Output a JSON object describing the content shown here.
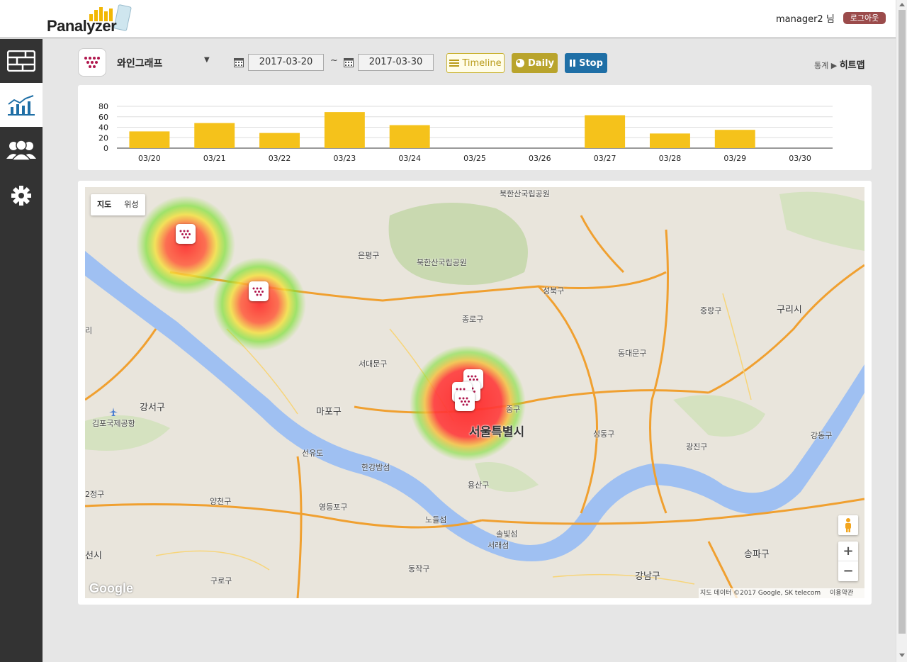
{
  "header": {
    "logo_text": "Panalyzer",
    "user": "manager2 님",
    "logout_label": "로그아웃"
  },
  "sidebar": {
    "items": [
      {
        "icon": "dashboard-icon"
      },
      {
        "icon": "chart-icon",
        "active": true
      },
      {
        "icon": "users-icon"
      },
      {
        "icon": "gear-icon"
      }
    ]
  },
  "toolbar": {
    "app_name": "와인그래프",
    "dropdown_symbol": "▼",
    "start_date": "2017-03-20",
    "tilde": "~",
    "end_date": "2017-03-30",
    "timeline_label": "Timeline",
    "daily_label": "Daily",
    "stop_label": "Stop"
  },
  "breadcrumb": {
    "parent": "통계",
    "arrow": "▶",
    "current": "히트맵"
  },
  "chart_data": {
    "type": "bar",
    "categories": [
      "03/20",
      "03/21",
      "03/22",
      "03/23",
      "03/24",
      "03/25",
      "03/26",
      "03/27",
      "03/28",
      "03/29",
      "03/30"
    ],
    "values": [
      32,
      48,
      29,
      69,
      44,
      0,
      0,
      63,
      28,
      35,
      0
    ],
    "yticks": [
      0,
      20,
      40,
      60,
      80
    ],
    "ylim": [
      0,
      80
    ],
    "color": "#f5c21b",
    "grid": true
  },
  "map": {
    "type_controls": {
      "map": "지도",
      "satellite": "위성"
    },
    "labels": [
      {
        "text": "북한산국립공원",
        "style": "sm"
      },
      {
        "text": "은평구",
        "style": "sm"
      },
      {
        "text": "북한산국립공원",
        "style": "sm"
      },
      {
        "text": "성북구",
        "style": "sm"
      },
      {
        "text": "종로구",
        "style": "sm"
      },
      {
        "text": "중랑구",
        "style": "sm"
      },
      {
        "text": "구리시",
        "style": "md"
      },
      {
        "text": "동대문구",
        "style": "sm"
      },
      {
        "text": "서대문구",
        "style": "sm"
      },
      {
        "text": "중구",
        "style": "sm"
      },
      {
        "text": "서울특별시",
        "style": "big"
      },
      {
        "text": "강서구",
        "style": "md"
      },
      {
        "text": "김포국제공항",
        "style": "sm"
      },
      {
        "text": "마포구",
        "style": "md"
      },
      {
        "text": "성동구",
        "style": "sm"
      },
      {
        "text": "광진구",
        "style": "sm"
      },
      {
        "text": "강동구",
        "style": "sm"
      },
      {
        "text": "선유도",
        "style": "sm"
      },
      {
        "text": "한강밤섬",
        "style": "sm"
      },
      {
        "text": "용산구",
        "style": "sm"
      },
      {
        "text": "2정구",
        "style": "sm"
      },
      {
        "text": "양천구",
        "style": "sm"
      },
      {
        "text": "영등포구",
        "style": "sm"
      },
      {
        "text": "노들섬",
        "style": "sm"
      },
      {
        "text": "솔빛섬",
        "style": "sm"
      },
      {
        "text": "서래섬",
        "style": "sm"
      },
      {
        "text": "송파구",
        "style": "md"
      },
      {
        "text": "선시",
        "style": "md"
      },
      {
        "text": "동작구",
        "style": "sm"
      },
      {
        "text": "강남구",
        "style": "md"
      },
      {
        "text": "구로구",
        "style": "sm"
      },
      {
        "text": "리",
        "style": "sm"
      }
    ],
    "google_logo": "Google",
    "attribution": "지도 데이터 ©2017 Google, SK telecom",
    "terms": "이용약관",
    "zoom_in": "+",
    "zoom_out": "−"
  }
}
